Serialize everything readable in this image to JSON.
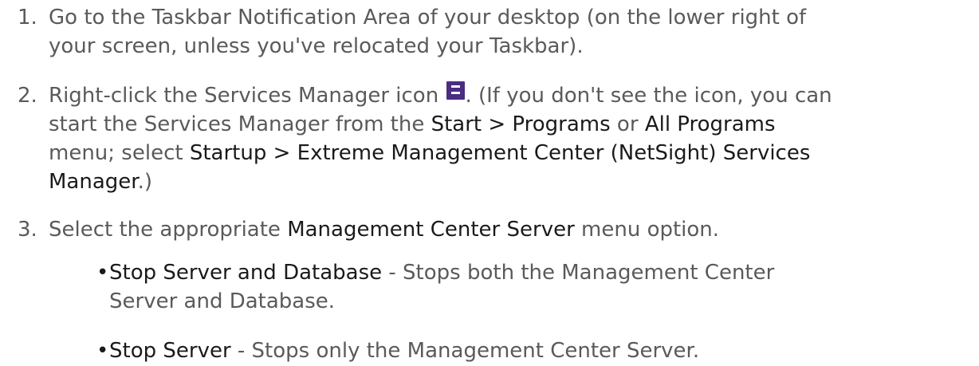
{
  "steps": [
    {
      "number": "1.",
      "line1": "Go to the Taskbar Notification Area of your desktop (on the lower right of",
      "line2": "your screen, unless you've relocated your Taskbar)."
    },
    {
      "number": "2.",
      "line1_a": "Right-click the Services Manager icon ",
      "icon": "services-manager-e-icon",
      "line1_b": ". (If you don't see the icon, you can",
      "line2_a": "start the Services Manager from the ",
      "line2_b1": "Start > Programs",
      "line2_c": " or ",
      "line2_b2": "All Programs",
      "line3_a": "menu; select ",
      "line3_b": "Startup > Extreme Management Center (NetSight) Services",
      "line4_b": "Manager",
      "line4_c": ".)"
    },
    {
      "number": "3.",
      "line1_a": "Select the appropriate ",
      "line1_b": "Management Center Server",
      "line1_c": " menu option."
    }
  ],
  "bullets": [
    {
      "dot": "•",
      "term": "Stop Server and Database",
      "desc_a": " - Stops both the Management Center",
      "desc_b": "Server and Database."
    },
    {
      "dot": "•",
      "term": "Stop Server",
      "desc_a": " - Stops only the Management Center Server."
    }
  ],
  "colors": {
    "body_text": "#5a5a5a",
    "emphasis_text": "#1a1a1a",
    "icon_bg": "#4b2d82"
  }
}
